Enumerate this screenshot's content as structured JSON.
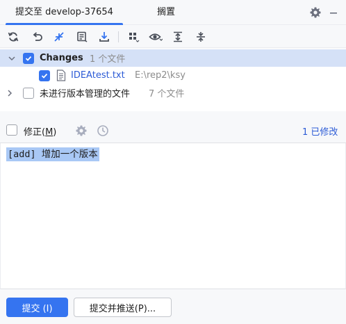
{
  "tabs": [
    {
      "label": "提交至 develop-37654",
      "active": true
    },
    {
      "label": "搁置",
      "active": false
    }
  ],
  "tabbar_icons": [
    "gear-icon",
    "minimize-icon"
  ],
  "toolbar": {
    "buttons": [
      "refresh-icon",
      "rollback-icon",
      "diff-icon",
      "shelve-icon",
      "update-icon",
      "group-by-icon",
      "preview-icon",
      "expand-all-icon",
      "collapse-all-icon"
    ]
  },
  "tree": {
    "changes": {
      "label": "Changes",
      "count": "1 个文件",
      "checked": true,
      "expanded": true
    },
    "file": {
      "name": "IDEAtest.txt",
      "path": "E:\\rep2\\ksy",
      "checked": true
    },
    "unversioned": {
      "label": "未进行版本管理的文件",
      "count": "7 个文件",
      "checked": false,
      "expanded": false
    }
  },
  "amend": {
    "label": "修正(M)",
    "label_prefix": "修正(",
    "mnemonic": "M",
    "label_suffix": ")",
    "checked": false,
    "modified": "1 已修改"
  },
  "message": {
    "text": "[add] 增加一个版本"
  },
  "buttons": {
    "commit": "提交 (I)",
    "commit_push": "提交并推送(P)..."
  },
  "colors": {
    "accent": "#3574f0",
    "link": "#2c5bd6",
    "selection": "#d5e1f7",
    "text_selection": "#a9c8f5"
  }
}
